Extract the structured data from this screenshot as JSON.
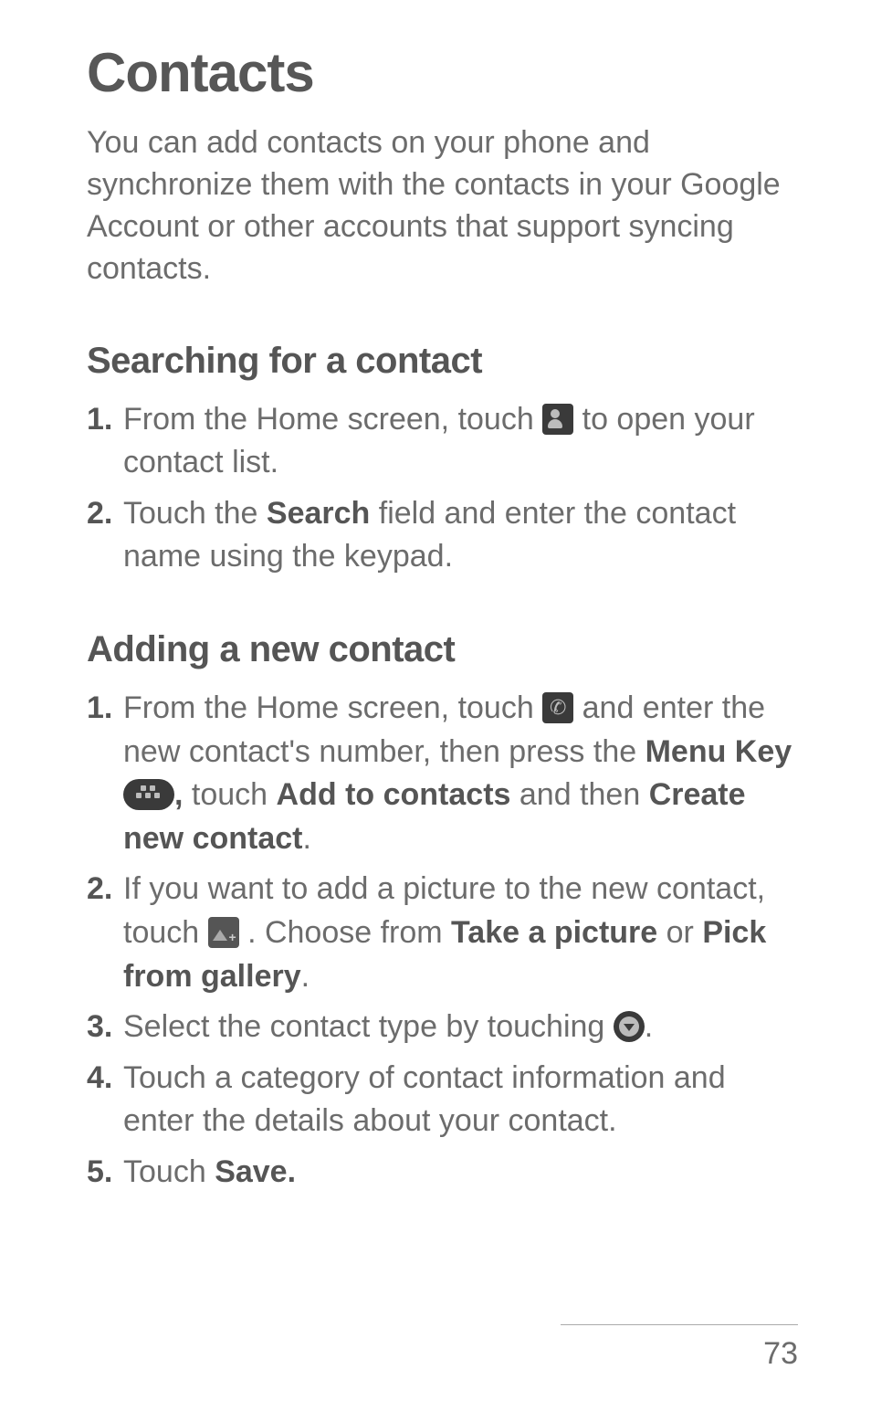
{
  "title": "Contacts",
  "intro": "You can add contacts on your phone and synchronize them with the contacts in your Google Account or other accounts that support syncing contacts.",
  "sections": [
    {
      "heading": "Searching for a contact",
      "items": [
        {
          "num": "1.",
          "parts": [
            "From the Home screen, touch ",
            {
              "icon": "contacts"
            },
            " to open your contact list."
          ]
        },
        {
          "num": "2.",
          "parts": [
            "Touch the ",
            {
              "bold": "Search"
            },
            " field and enter the contact name using the keypad."
          ]
        }
      ]
    },
    {
      "heading": "Adding a new contact",
      "items": [
        {
          "num": "1.",
          "parts": [
            "From the Home screen, touch ",
            {
              "icon": "phone"
            },
            " and enter the new contact's number, then press the ",
            {
              "bold": "Menu Key"
            },
            " ",
            {
              "icon": "menu"
            },
            {
              "bold": ","
            },
            " touch ",
            {
              "bold": "Add to contacts"
            },
            " and then ",
            {
              "bold": "Create new contact"
            },
            "."
          ]
        },
        {
          "num": "2.",
          "parts": [
            "If you want to add a picture to the new contact, touch ",
            {
              "icon": "photo"
            },
            " . Choose from ",
            {
              "bold": "Take a picture"
            },
            " or ",
            {
              "bold": "Pick from gallery"
            },
            "."
          ]
        },
        {
          "num": "3.",
          "parts": [
            "Select the contact type by touching ",
            {
              "icon": "dropdown"
            },
            "."
          ]
        },
        {
          "num": "4.",
          "parts": [
            "Touch a category of contact information and enter the details about your contact."
          ]
        },
        {
          "num": "5.",
          "parts": [
            "Touch ",
            {
              "bold": "Save."
            }
          ]
        }
      ]
    }
  ],
  "page_number": "73"
}
